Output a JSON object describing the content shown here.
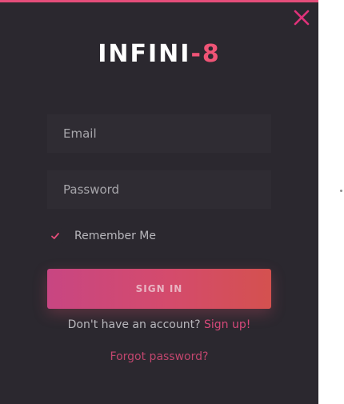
{
  "logo": {
    "primary": "INFINI",
    "accent": "-8"
  },
  "form": {
    "email_placeholder": "Email",
    "password_placeholder": "Password",
    "remember_label": "Remember Me",
    "remember_checked": true,
    "signin_label": "SIGN IN"
  },
  "footer": {
    "no_account_text": "Don't have an account?",
    "signup_label": "Sign up!",
    "forgot_label": "Forgot password?"
  },
  "icons": {
    "close": "close-icon",
    "check": "check-icon"
  },
  "colors": {
    "panel_bg": "#2b282f",
    "field_bg": "#2f2c33",
    "accent_pink": "#e54d7a",
    "logo_accent": "#ef5476",
    "button_gradient_start": "#c84682",
    "button_gradient_end": "#d4514f"
  }
}
